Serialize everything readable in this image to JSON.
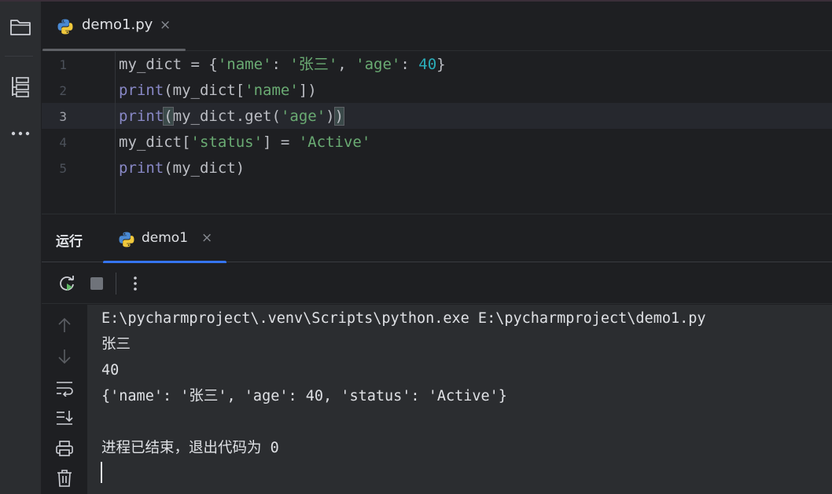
{
  "editor": {
    "tab": {
      "label": "demo1.py",
      "close": "×"
    },
    "lines": [
      {
        "num": "1",
        "tokens": [
          {
            "t": "my_dict = {",
            "c": "c-var"
          },
          {
            "t": "'name'",
            "c": "c-str"
          },
          {
            "t": ": ",
            "c": "c-var"
          },
          {
            "t": "'张三'",
            "c": "c-str"
          },
          {
            "t": ", ",
            "c": "c-var"
          },
          {
            "t": "'age'",
            "c": "c-str"
          },
          {
            "t": ": ",
            "c": "c-var"
          },
          {
            "t": "40",
            "c": "c-num"
          },
          {
            "t": "}",
            "c": "c-var"
          }
        ]
      },
      {
        "num": "2",
        "tokens": [
          {
            "t": "print",
            "c": "c-kw"
          },
          {
            "t": "(my_dict[",
            "c": "c-var"
          },
          {
            "t": "'name'",
            "c": "c-str"
          },
          {
            "t": "])",
            "c": "c-var"
          }
        ]
      },
      {
        "num": "3",
        "active": true,
        "tokens": [
          {
            "t": "print",
            "c": "c-kw"
          },
          {
            "t": "(",
            "c": "c-paren-hl"
          },
          {
            "t": "my_dict.get(",
            "c": "c-var"
          },
          {
            "t": "'age'",
            "c": "c-str"
          },
          {
            "t": ")",
            "c": "c-var"
          },
          {
            "t": ")",
            "c": "c-paren-hl"
          }
        ]
      },
      {
        "num": "4",
        "tokens": [
          {
            "t": "my_dict[",
            "c": "c-var"
          },
          {
            "t": "'status'",
            "c": "c-str"
          },
          {
            "t": "] = ",
            "c": "c-var"
          },
          {
            "t": "'Active'",
            "c": "c-str"
          }
        ]
      },
      {
        "num": "5",
        "tokens": [
          {
            "t": "print",
            "c": "c-kw"
          },
          {
            "t": "(my_dict)",
            "c": "c-var"
          }
        ]
      }
    ]
  },
  "run_panel": {
    "title": "运行",
    "tab": {
      "label": "demo1",
      "close": "×"
    }
  },
  "console": {
    "lines": [
      "E:\\pycharmproject\\.venv\\Scripts\\python.exe E:\\pycharmproject\\demo1.py",
      "张三",
      "40",
      "{'name': '张三', 'age': 40, 'status': 'Active'}",
      "",
      "进程已结束，退出代码为 0"
    ]
  },
  "icons": {
    "left_bar": [
      "folder-icon",
      "structure-icon",
      "more-icon"
    ],
    "run_toolbar": [
      "rerun-icon",
      "stop-icon",
      "more-vertical-icon"
    ],
    "console_side": [
      "up-arrow-icon",
      "down-arrow-icon",
      "soft-wrap-icon",
      "scroll-to-end-icon",
      "print-icon",
      "trash-icon"
    ]
  },
  "colors": {
    "accent": "#3574f0",
    "string": "#6aab73",
    "keyword": "#8888c6",
    "number": "#2aacb8"
  }
}
